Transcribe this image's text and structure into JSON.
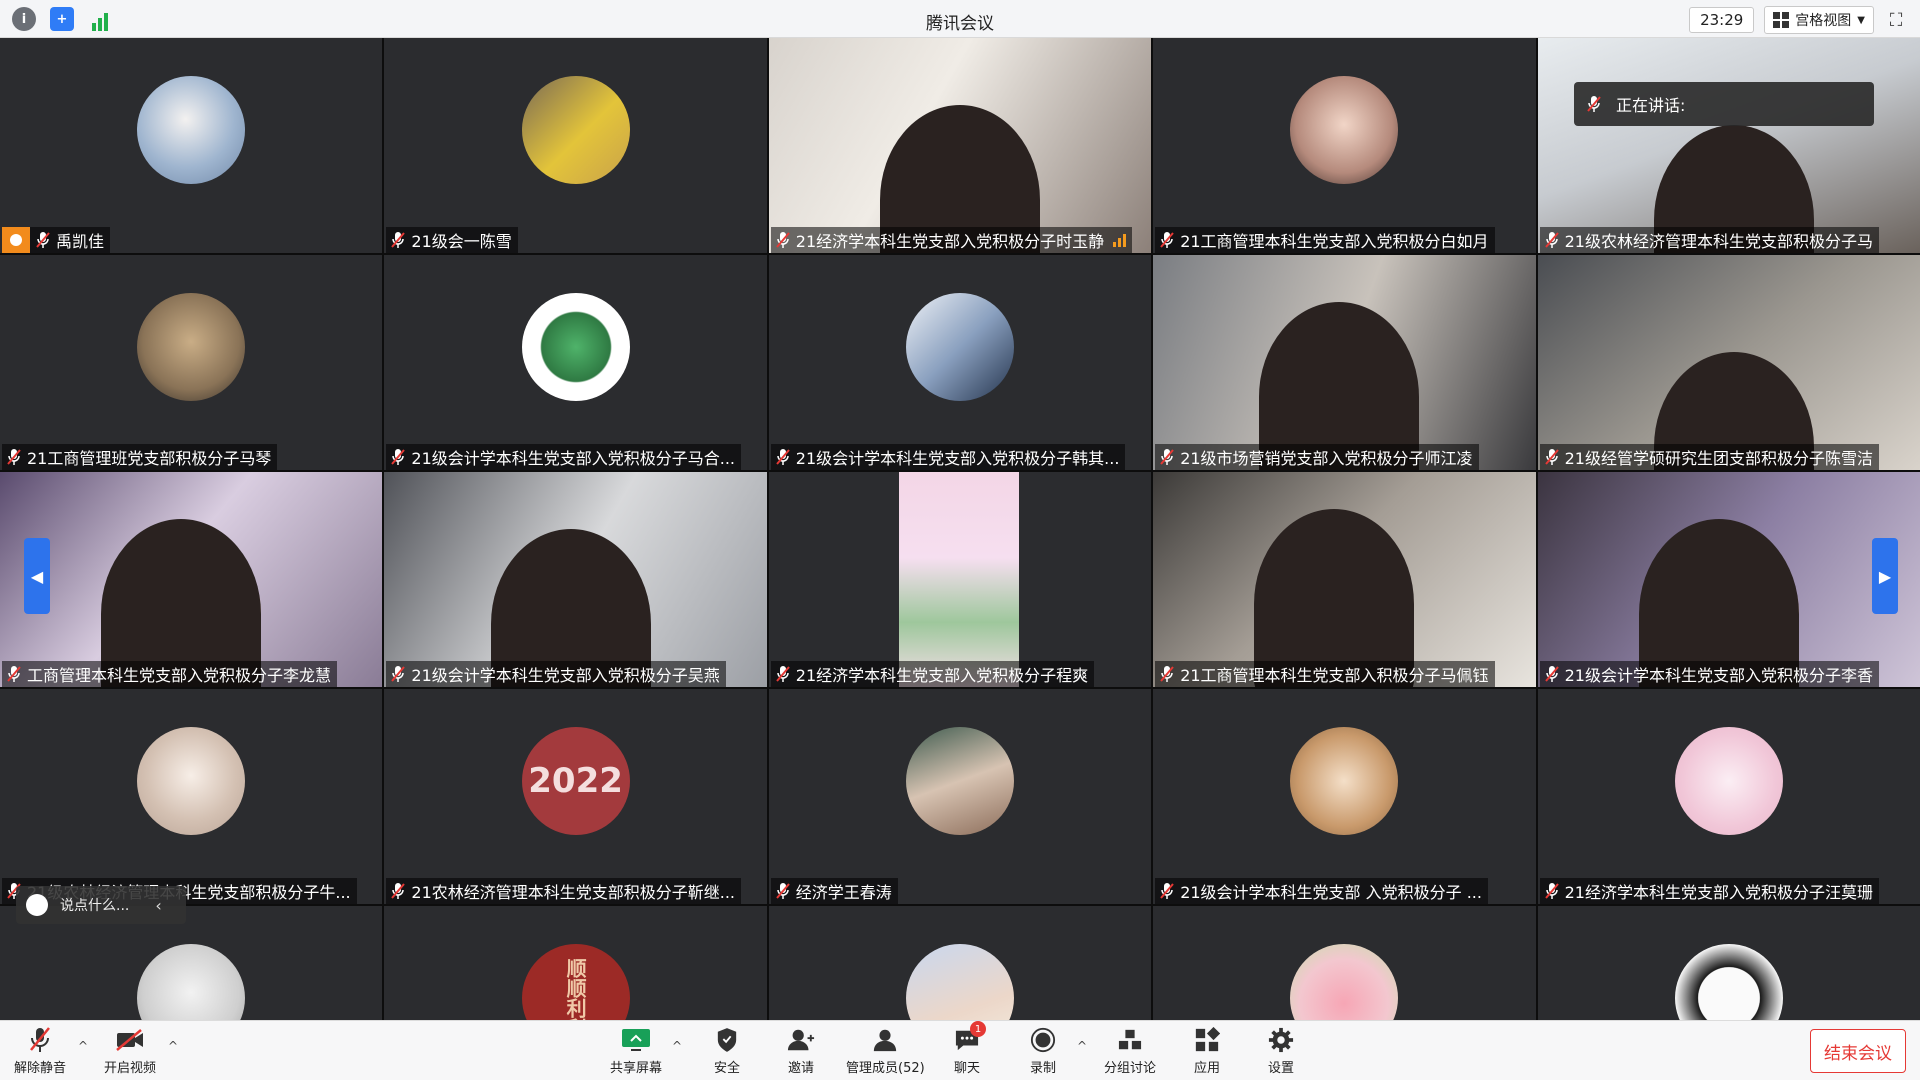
{
  "window": {
    "title": "腾讯会议",
    "clock": "23:29",
    "view_label": "宫格视图"
  },
  "speaking": {
    "label": "正在讲话:"
  },
  "chat": {
    "placeholder": "说点什么..."
  },
  "participants": [
    "禹凯佳",
    "21级会一陈雪",
    "21经济学本科生党支部入党积极分子时玉静",
    "21工商管理本科生党支部入党积极分白如月",
    "21级农林经济管理本科生党支部积极分子马",
    "21工商管理班党支部积极分子马琴",
    "21级会计学本科生党支部入党积极分子马合...",
    "21级会计学本科生党支部入党积极分子韩其...",
    "21级市场营销党支部入党积极分子师江凌",
    "21级经管学硕研究生团支部积极分子陈雪洁",
    "工商管理本科生党支部入党积极分子李龙慧",
    "21级会计学本科生党支部入党积极分子吴燕",
    "21经济学本科生党支部入党积极分子程爽",
    "21工商管理本科生党支部入积极分子马佩钰",
    "21级会计学本科生党支部入党积极分子李香",
    "21级农林经济管理本科生党支部积极分子牛...",
    "21农林经济管理本科生党支部积极分子靳继...",
    "经济学王春涛",
    "21级会计学本科生党支部 入党积极分子 ...",
    "21经济学本科生党支部入党积极分子汪莫珊"
  ],
  "avatar_text": {
    "year": "2022",
    "lucky": "顺顺利利"
  },
  "toolbar": {
    "unmute": "解除静音",
    "video": "开启视频",
    "share": "共享屏幕",
    "security": "安全",
    "invite": "邀请",
    "members": "管理成员(52)",
    "chat": "聊天",
    "chat_badge": "1",
    "record": "录制",
    "breakout": "分组讨论",
    "apps": "应用",
    "settings": "设置",
    "end": "结束会议"
  }
}
